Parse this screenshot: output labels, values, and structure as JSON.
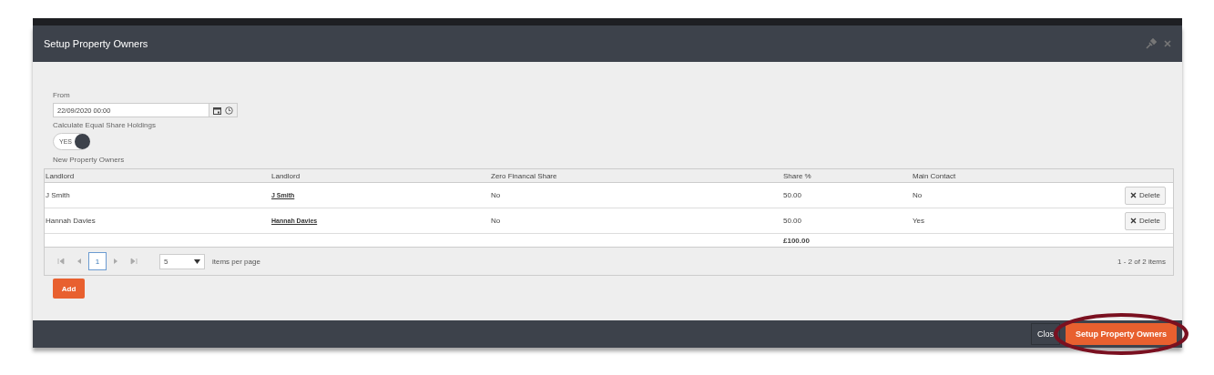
{
  "dialog": {
    "title": "Setup Property Owners"
  },
  "from": {
    "label": "From",
    "value": "22/09/2020 00:00"
  },
  "equal_share": {
    "label": "Calculate Equal Share Holdings",
    "toggle_text": "YES",
    "on": true
  },
  "owners": {
    "label": "New Property Owners",
    "columns": [
      "Landlord",
      "Landlord",
      "Zero Financal Share",
      "Share %",
      "Main Contact"
    ],
    "rows": [
      {
        "landlord": "J Smith",
        "landlord_link": "J Smith",
        "zero_financial_share": "No",
        "share": "50.00",
        "main_contact": "No",
        "action": "Delete"
      },
      {
        "landlord": "Hannah Davies",
        "landlord_link": "Hannah Davies",
        "zero_financial_share": "No",
        "share": "50.00",
        "main_contact": "Yes",
        "action": "Delete"
      }
    ],
    "total": "£100.00",
    "pager": {
      "pages": [
        {
          "label": "1",
          "selected": true
        }
      ],
      "page_size": "5",
      "page_size_label": "items per page",
      "summary": "1 - 2 of 2 items"
    }
  },
  "add_button": "Add",
  "footer_buttons": [
    {
      "label": "Clos",
      "kind": "secondary",
      "highlighted": false
    },
    {
      "label": "Setup Property Owners",
      "kind": "primary",
      "highlighted": true
    }
  ]
}
